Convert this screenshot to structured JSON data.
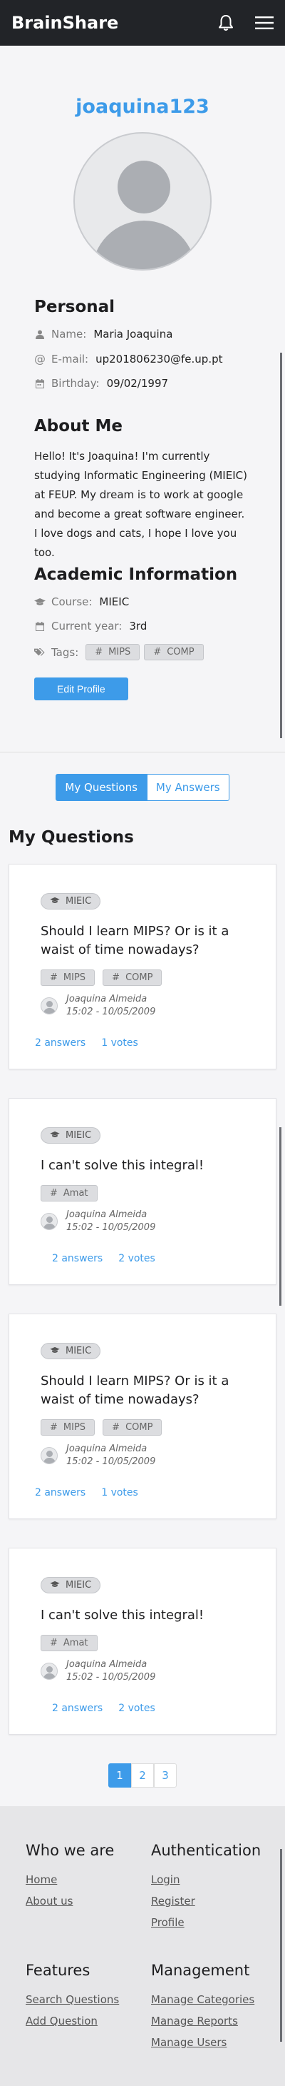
{
  "nav": {
    "brand": "BrainShare",
    "bell_icon": "bell-icon",
    "menu_icon": "hamburger-menu-icon"
  },
  "profile": {
    "username": "joaquina123",
    "personal_heading": "Personal",
    "name_label": "Name:",
    "name_value": "Maria Joaquina",
    "email_label": "E-mail:",
    "email_value": "up201806230@fe.up.pt",
    "birthday_label": "Birthday:",
    "birthday_value": "09/02/1997",
    "about_heading": "About Me",
    "about_text": "Hello! It's Joaquina! I'm currently studying Informatic Engineering (MIEIC) at FEUP. My dream is to work at google and become a great software engineer. I love dogs and cats, I hope I love you too.",
    "academic_heading": "Academic Information",
    "course_label": "Course:",
    "course_value": "MIEIC",
    "year_label": "Current year:",
    "year_value": "3rd",
    "tags_label": "Tags:",
    "tags": [
      "MIPS",
      "COMP"
    ],
    "edit_button": "Edit Profile"
  },
  "tabs": {
    "my_questions": "My Questions",
    "my_answers": "My Answers"
  },
  "questions_heading": "My Questions",
  "questions": [
    {
      "course": "MIEIC",
      "title": "Should I learn MIPS? Or is it a waist of time nowadays?",
      "tags": [
        "MIPS",
        "COMP"
      ],
      "author": "Joaquina Almeida",
      "date": "15:02 - 10/05/2009",
      "answers": "2 answers",
      "votes": "1 votes"
    },
    {
      "course": "MIEIC",
      "title": "I can't solve this integral!",
      "tags": [
        "Amat"
      ],
      "author": "Joaquina Almeida",
      "date": "15:02 - 10/05/2009",
      "answers": "2 answers",
      "votes": "2 votes"
    },
    {
      "course": "MIEIC",
      "title": "Should I learn MIPS? Or is it a waist of time nowadays?",
      "tags": [
        "MIPS",
        "COMP"
      ],
      "author": "Joaquina Almeida",
      "date": "15:02 - 10/05/2009",
      "answers": "2 answers",
      "votes": "1 votes"
    },
    {
      "course": "MIEIC",
      "title": "I can't solve this integral!",
      "tags": [
        "Amat"
      ],
      "author": "Joaquina Almeida",
      "date": "15:02 - 10/05/2009",
      "answers": "2 answers",
      "votes": "2 votes"
    }
  ],
  "pagination": [
    "1",
    "2",
    "3"
  ],
  "footer": {
    "who_heading": "Who we are",
    "home": "Home",
    "about": "About us",
    "auth_heading": "Authentication",
    "login": "Login",
    "register": "Register",
    "profile": "Profile",
    "features_heading": "Features",
    "search": "Search Questions",
    "add": "Add Question",
    "management_heading": "Management",
    "categories": "Manage Categories",
    "reports": "Manage Reports",
    "users": "Manage Users"
  },
  "colors": {
    "accent": "#3d9be9",
    "navbar": "#222428",
    "footer_bg": "#e6e6e8"
  }
}
